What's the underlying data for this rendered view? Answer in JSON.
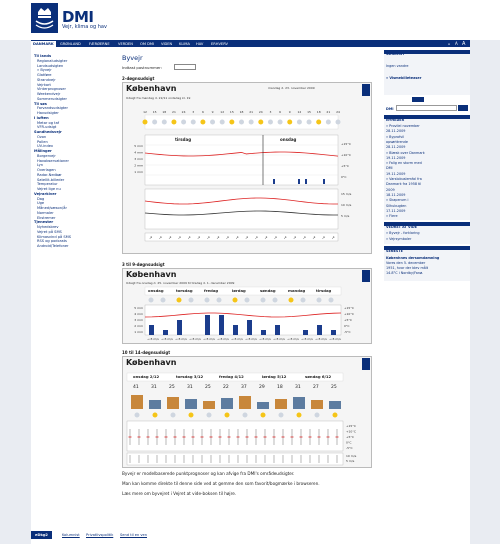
{
  "site": {
    "title": "DMI",
    "subtitle": "Vejr, klima og hav"
  },
  "topnav": [
    "DANMARK",
    "GRØNLAND",
    "FÆRØERNE",
    "VERDEN",
    "OM DMI",
    "VIDEN",
    "KLIMA",
    "HAV",
    "ERHVERV"
  ],
  "topright": [
    "A",
    "A",
    "A"
  ],
  "leftnav": [
    {
      "label": "Til lands",
      "h": true
    },
    {
      "label": "Regionaludsigter"
    },
    {
      "label": "Landsudsigten"
    },
    {
      "label": "» Byvejr"
    },
    {
      "label": "Glatføre"
    },
    {
      "label": "Strandvejr"
    },
    {
      "label": "Vejrkort"
    },
    {
      "label": "Vinterprognoser"
    },
    {
      "label": "Weekendvejr"
    },
    {
      "label": "Sommerudsigter"
    },
    {
      "label": "Til søs",
      "h": true
    },
    {
      "label": "Farvandsudsigter"
    },
    {
      "label": "Havudsigter"
    },
    {
      "label": "I luften",
      "h": true
    },
    {
      "label": "Metar og taf"
    },
    {
      "label": "VFR-udsigt"
    },
    {
      "label": "Sundhedsvejr",
      "h": true
    },
    {
      "label": "Ozon"
    },
    {
      "label": "Pollen"
    },
    {
      "label": "UV-index"
    },
    {
      "label": "Målinger",
      "h": true
    },
    {
      "label": "Borgervejr"
    },
    {
      "label": "Havobservationer"
    },
    {
      "label": "Lyn"
    },
    {
      "label": "Overlagen"
    },
    {
      "label": "Radar-Nedbør"
    },
    {
      "label": "Satellit-billeder"
    },
    {
      "label": "Temperatur"
    },
    {
      "label": "Vejret lige nu"
    },
    {
      "label": "Vejrarkiver",
      "h": true
    },
    {
      "label": "Dag"
    },
    {
      "label": "Uge"
    },
    {
      "label": "Måned/sæson/år"
    },
    {
      "label": "Normaler"
    },
    {
      "label": "Ekstremer"
    },
    {
      "label": "Tjenester",
      "h": true
    },
    {
      "label": "Nyhedsbrev"
    },
    {
      "label": "Vejret på SMS"
    },
    {
      "label": "Klimasvind på SMS"
    },
    {
      "label": "RSS og podcasts"
    },
    {
      "label": "Android/Telefoner"
    }
  ],
  "main": {
    "title": "Byvejr",
    "search_label": "Indtast postnummer:",
    "sec1": "2-døgnsudsigt",
    "city": "København",
    "date1": "mandag d. 23. november 2009",
    "issued1": "Udsigt fra mandag d. 22/11 ondsdag kl. 19",
    "sec2": "3 til 9-døgnsudsigt",
    "issued2": "Udsigt fra onsdag d. 25. november 2009 til tirsdag d. 1. december 2009",
    "sec3": "10 til 14-døgnsudsigt",
    "text1": "Byvejr er modelbaserede punktprognoser og kan afvige fra DMI's områdeudsigter.",
    "text2": "Man kan komme direkte til denne side ved at gemme den som favorit/bogmærke i browseren.",
    "text3": "Læs mere om byvejret i Vejret at vide-boksen til højre."
  },
  "chart2day": {
    "hours": [
      "12",
      "15",
      "18",
      "21",
      "24",
      "3",
      "6",
      "9",
      "12",
      "15",
      "18",
      "21",
      "24",
      "3",
      "6",
      "9",
      "12",
      "15",
      "18",
      "21",
      "24"
    ],
    "days": [
      "tirsdag",
      "onsdag"
    ],
    "temp_labels": [
      "+15°C",
      "+10°C",
      "+5°C",
      "0°C"
    ],
    "wind_labels": [
      "15 m/s",
      "10 m/s",
      "5 m/s"
    ],
    "rain_labels": [
      "5 mm",
      "4 mm",
      "3 mm",
      "2 mm",
      "1 mm"
    ]
  },
  "chart9day": {
    "days": [
      "onsdag",
      "torsdag",
      "fredag",
      "lørdag",
      "søndag",
      "mandag",
      "tirsdag"
    ],
    "temp_labels": [
      "+15°C",
      "+10°C",
      "+5°C",
      "0°C",
      "-5°C"
    ],
    "rain_labels": [
      "5 mm",
      "4 mm",
      "3 mm",
      "2 mm",
      "1 mm"
    ]
  },
  "chart14day": {
    "days": [
      "onsdag 2/12",
      "torsdag 3/12",
      "fredag 4/12",
      "lørdag 5/12",
      "søndag 6/12"
    ],
    "temps": [
      "41",
      "31",
      "25",
      "31",
      "25",
      "22",
      "37",
      "29",
      "18",
      "31",
      "27",
      "25"
    ],
    "temp_labels": [
      "+15°C",
      "+10°C",
      "+5°C",
      "0°C",
      "-5°C"
    ],
    "wind_labels": [
      "10 m/s",
      "5 m/s"
    ]
  },
  "right": {
    "search_hdr": "SØGELIST",
    "search_none": "Ingen vandre",
    "search_link": "» Vismebilleteaser",
    "dmi_label": "DMI",
    "nyheder_hdr": "NYHEDER",
    "nyheder": [
      "» Provilel november",
      "28.11.2009",
      "» Byprofvil",
      "opsørttrende",
      "28.11.2009",
      "» Blæsk over Danmark",
      "19.11.2009",
      "» Falig en storm med",
      "DMI",
      "19.11.2009",
      "» Varslobuslemfal fra",
      "Danmark fra 1958 til",
      "2009",
      "18.11.2009",
      "» Skaperum i",
      "Silhubugten",
      "17.11.2009",
      "» Flere"
    ],
    "vejret_hdr": "VEDRET AT VIDE",
    "vejret": [
      "» Byvejr - forklaring",
      "» Vejrsymboler"
    ],
    "senest_hdr": "SENESTE",
    "senest": [
      "Københnes dersomdamning",
      "Vores den 5. december",
      "1951, hvor der blev målt",
      "14.8°C i Nordby/Fanø."
    ]
  },
  "footer": {
    "tag": "eDkg2",
    "links": [
      "Kolumnist",
      "Privatlivspolitik",
      "Send til en ven"
    ]
  }
}
